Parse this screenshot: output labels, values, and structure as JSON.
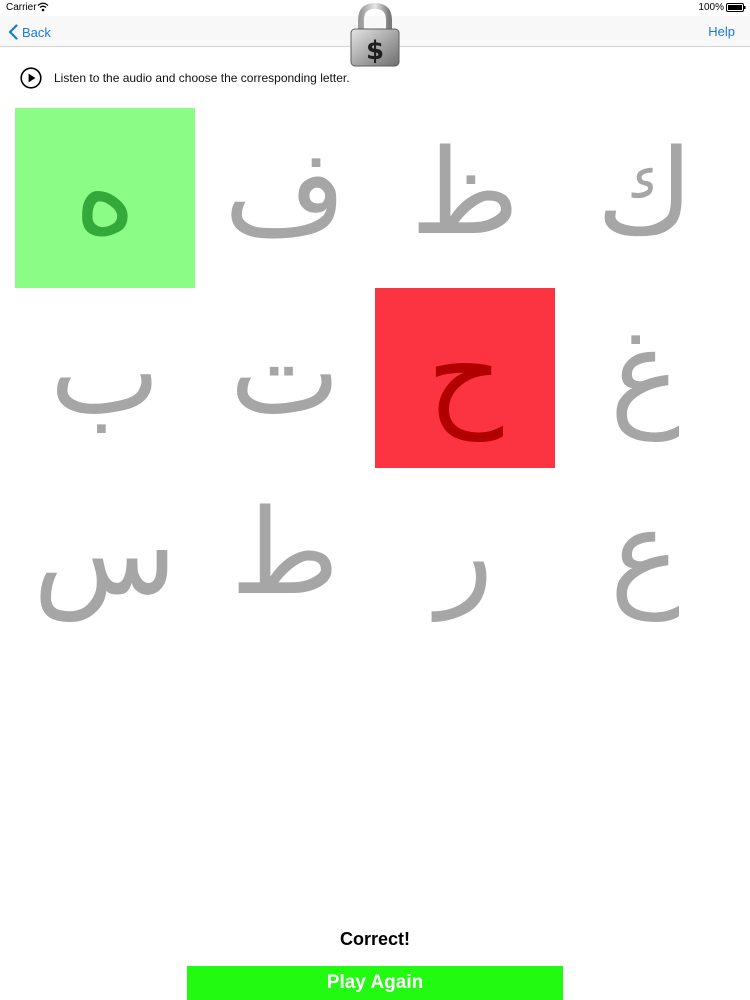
{
  "status_bar": {
    "carrier": "Carrier",
    "battery": "100%"
  },
  "nav": {
    "back_label": "Back",
    "help_label": "Help",
    "lock_icon": "padlock-dollar-icon"
  },
  "instruction": {
    "play_icon": "play-circle-icon",
    "text": "Listen to the audio and choose the corresponding letter."
  },
  "grid": {
    "rows": [
      [
        {
          "letter": "ه",
          "state": "correct"
        },
        {
          "letter": "ف",
          "state": "default"
        },
        {
          "letter": "ظ",
          "state": "default"
        },
        {
          "letter": "ك",
          "state": "default"
        }
      ],
      [
        {
          "letter": "ب",
          "state": "default"
        },
        {
          "letter": "ت",
          "state": "default"
        },
        {
          "letter": "ح",
          "state": "wrong"
        },
        {
          "letter": "غ",
          "state": "default"
        }
      ],
      [
        {
          "letter": "س",
          "state": "default"
        },
        {
          "letter": "ط",
          "state": "default"
        },
        {
          "letter": "ر",
          "state": "default"
        },
        {
          "letter": "ع",
          "state": "default"
        }
      ]
    ]
  },
  "result": {
    "message": "Correct!",
    "play_again_label": "Play Again"
  },
  "colors": {
    "tint": "#1a7ad9",
    "correct_bg": "#8bfc86",
    "correct_fg": "#35a83a",
    "wrong_bg": "#fc3341",
    "wrong_fg": "#b00000",
    "default_fg": "#a6a6a6",
    "play_again_bg": "#22fa12"
  }
}
